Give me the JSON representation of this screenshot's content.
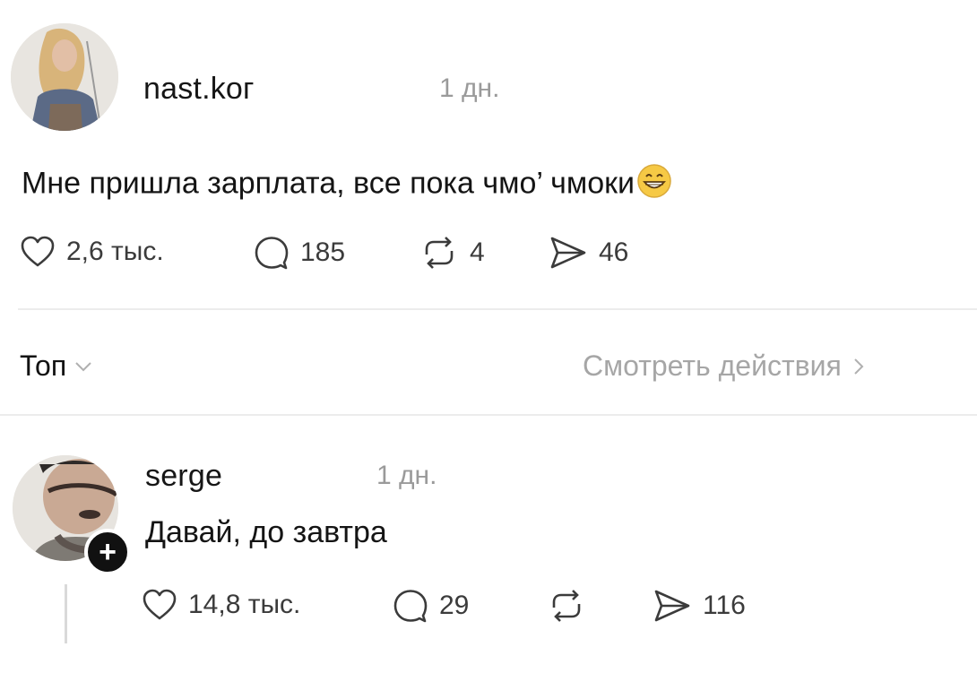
{
  "post": {
    "author": "nast.koг",
    "time": "1 дн.",
    "text": "Мне пришла зарплата, все пока чмо’ чмоки",
    "emoji": "grinning-face-emoji",
    "actions": {
      "likes": "2,6 тыс.",
      "comments": "185",
      "reposts": "4",
      "shares": "46"
    }
  },
  "sort_bar": {
    "sort_label": "Топ",
    "view_activity_label": "Смотреть действия"
  },
  "reply": {
    "author": "serge",
    "time": "1 дн.",
    "text": "Давай, до завтра",
    "follow_symbol": "+",
    "actions": {
      "likes": "14,8 тыс.",
      "comments": "29",
      "shares": "116"
    }
  },
  "colors": {
    "background": "#ffffff",
    "text": "#141414",
    "muted": "#9a9a9a",
    "divider": "#ececec"
  }
}
